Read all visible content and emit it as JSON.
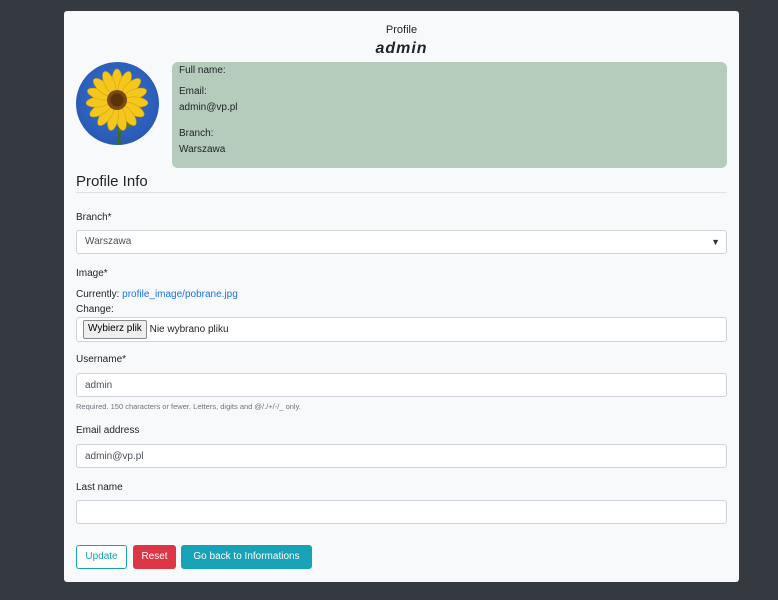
{
  "header": {
    "label": "Profile",
    "username": "admin"
  },
  "info": {
    "full_name_label": "Full name:",
    "full_name_value": "",
    "email_label": "Email:",
    "email_value": "admin@vp.pl",
    "branch_label": "Branch:",
    "branch_value": "Warszawa"
  },
  "section_title": "Profile Info",
  "form": {
    "branch": {
      "label": "Branch*",
      "value": "Warszawa"
    },
    "image": {
      "label": "Image*",
      "currently_label": "Currently:",
      "current_file": "profile_image/pobrane.jpg",
      "change_label": "Change:",
      "choose_button": "Wybierz plik",
      "no_file_text": "Nie wybrano pliku"
    },
    "username": {
      "label": "Username*",
      "value": "admin",
      "help": "Required. 150 characters or fewer. Letters, digits and @/./+/-/_ only."
    },
    "email": {
      "label": "Email address",
      "value": "admin@vp.pl"
    },
    "last_name": {
      "label": "Last name",
      "value": ""
    }
  },
  "buttons": {
    "update": "Update",
    "reset": "Reset",
    "back": "Go back to Informations"
  },
  "colors": {
    "background": "#343a40",
    "card": "#f8f9fa",
    "info_box": "#b5cbbb",
    "info_accent": "#17a2b8",
    "danger": "#dc3545"
  }
}
